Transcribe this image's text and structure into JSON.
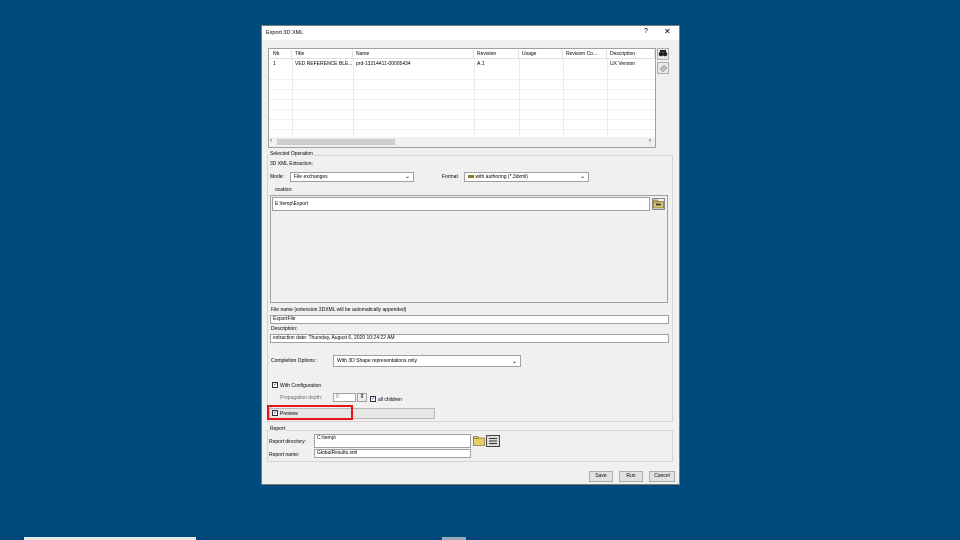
{
  "dialog": {
    "title": "Export 3D XML",
    "help_label": "?",
    "close_label": "✕"
  },
  "table": {
    "columns": [
      "Nb",
      "Title",
      "Name",
      "Revision",
      "Usage",
      "Revision Co...",
      "Description"
    ],
    "rows": [
      [
        "1",
        "VED REFERENCE BLE...",
        "prd-13214411-00005434",
        "A.1",
        "",
        "",
        "UX Version"
      ]
    ],
    "scroll_left": "‹",
    "scroll_right": "›"
  },
  "selected_operation": {
    "group_label": "Selected Operation",
    "extraction_label": "3D XML Extraction:",
    "mode_label": "Mode:",
    "mode_value": "File exchanges",
    "format_label": "Format",
    "format_value": "with authoring (*.3dxml)",
    "location_label": "ocation:",
    "location_value": "E:\\temp\\Export",
    "filename_label": "File name (extension 3DXML will be automatically appended)",
    "filename_value": "ExportFile",
    "description_label": "Description:",
    "description_value": "extraction date: Thursday, August 6, 2020 10:24:22 AM",
    "completion_label": "Completion Options :",
    "completion_value": "With 3D Shape representations only",
    "with_configuration_label": "With Configuration",
    "propagation_label": "Propagation depth:",
    "propagation_value": "0",
    "all_children_label": "all children",
    "preview_label": "Preview"
  },
  "report": {
    "group_label": "Report",
    "directory_label": "Report directory:",
    "directory_value": "C:\\temp\\",
    "name_label": "Report name:",
    "name_value": "GlobalResults.xml"
  },
  "buttons": {
    "save": "Save",
    "run": "Run",
    "cancel": "Cancel"
  },
  "colors": {
    "desktop": "#004a7c",
    "highlight_box": "#e8141c",
    "checkbox_tick": "#1f5fbf"
  },
  "icons": {
    "chevron": "⌄",
    "check": "✓",
    "spin": "⇕"
  }
}
